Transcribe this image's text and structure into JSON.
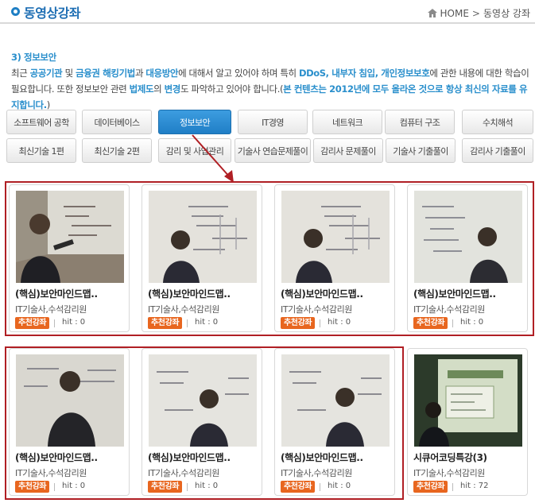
{
  "header": {
    "title": "동영상강좌",
    "breadcrumb": {
      "home": "HOME",
      "separator": ">",
      "current": "동영상 강좌"
    }
  },
  "intro": {
    "section": "3) 정보보안",
    "p1": "최근 ",
    "h1": "공공기관",
    "p2": " 및 ",
    "h2": "금융권 해킹기법",
    "p3": "과 ",
    "h3": "대응방안",
    "p4": "에 대해서 알고 있어야 하며 특히 ",
    "h4": "DDoS, 내부자 침입, 개인정보보호",
    "p5": "에 관한 내용에 대한 학습이 필요합니다. 또한 정보보안 관련 ",
    "h5": "법제도",
    "p6": "의 ",
    "h6": "변경",
    "p7": "도 파악하고 있어야 합니다.(",
    "h7": "본 컨텐츠는 2012년에 모두 올라온 것으로 항상 최신의 자료를 유지합니다.",
    "p8": ")"
  },
  "tabs": {
    "row1": [
      "소프트웨어 공학",
      "데이터베이스",
      "정보보안",
      "IT경영",
      "네트워크",
      "컴퓨터 구조",
      "수치해석"
    ],
    "row2": [
      "최신기술 1편",
      "최신기술 2편",
      "감리 및 사업관리",
      "기술사 연습문제풀이",
      "감리사 문제풀이",
      "기술사 기출풀이",
      "감리사 기출풀이"
    ],
    "active": "정보보안"
  },
  "cards": [
    {
      "title": "(핵심)보안마인드맵..",
      "author": "IT기술사,수석감리원",
      "badge": "추천강좌",
      "hit": "hit : 0"
    },
    {
      "title": "(핵심)보안마인드맵..",
      "author": "IT기술사,수석감리원",
      "badge": "추천강좌",
      "hit": "hit : 0"
    },
    {
      "title": "(핵심)보안마인드맵..",
      "author": "IT기술사,수석감리원",
      "badge": "추천강좌",
      "hit": "hit : 0"
    },
    {
      "title": "(핵심)보안마인드맵..",
      "author": "IT기술사,수석감리원",
      "badge": "추천강좌",
      "hit": "hit : 0"
    },
    {
      "title": "(핵심)보안마인드맵..",
      "author": "IT기술사,수석감리원",
      "badge": "추천강좌",
      "hit": "hit : 0"
    },
    {
      "title": "(핵심)보안마인드맵..",
      "author": "IT기술사,수석감리원",
      "badge": "추천강좌",
      "hit": "hit : 0"
    },
    {
      "title": "(핵심)보안마인드맵..",
      "author": "IT기술사,수석감리원",
      "badge": "추천강좌",
      "hit": "hit : 0"
    },
    {
      "title": "시큐어코딩특강(3)",
      "author": "IT기술사,수석감리원",
      "badge": "추천강좌",
      "hit": "hit : 72"
    }
  ],
  "colors": {
    "accent": "#1f7ec6",
    "highlight": "#2a8fcc",
    "badge": "#e8661f",
    "annotation": "#b01f24"
  }
}
